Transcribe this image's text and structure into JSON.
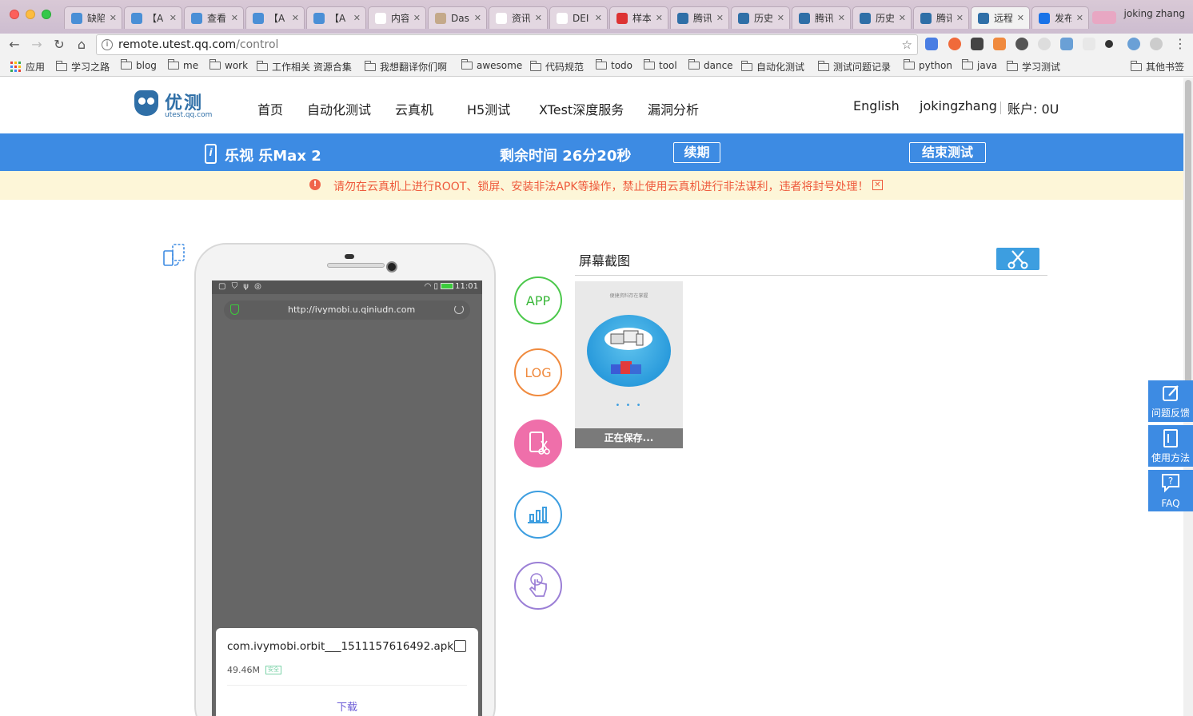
{
  "browser": {
    "profile_name": "joking zhang",
    "tabs": [
      {
        "title": "缺陷",
        "color": "#4a8fd6"
      },
      {
        "title": "【A",
        "color": "#4a8fd6"
      },
      {
        "title": "查看",
        "color": "#4a8fd6"
      },
      {
        "title": "【A",
        "color": "#4a8fd6"
      },
      {
        "title": "【A",
        "color": "#4a8fd6"
      },
      {
        "title": "内容",
        "color": "#ffffff"
      },
      {
        "title": "Das",
        "color": "#c4a98a"
      },
      {
        "title": "资讯",
        "color": "#ffffff"
      },
      {
        "title": "DEI",
        "color": "#ffffff"
      },
      {
        "title": "样本",
        "color": "#d33"
      },
      {
        "title": "腾讯",
        "color": "#2f6fa7"
      },
      {
        "title": "历史",
        "color": "#2f6fa7"
      },
      {
        "title": "腾讯",
        "color": "#2f6fa7"
      },
      {
        "title": "历史",
        "color": "#2f6fa7"
      },
      {
        "title": "腾讯",
        "color": "#2f6fa7"
      },
      {
        "title": "远程",
        "color": "#2f6fa7",
        "active": true
      },
      {
        "title": "发布",
        "color": "#1a73e8"
      }
    ],
    "url_host": "remote.utest.qq.com",
    "url_path": "/control",
    "bookmarks": [
      "应用",
      "学习之路",
      "blog",
      "me",
      "work",
      "工作相关 资源合集",
      "我想翻译你们啊",
      "awesome",
      "代码规范",
      "todo",
      "tool",
      "dance",
      "自动化测试",
      "测试问题记录",
      "python",
      "java",
      "学习测试"
    ],
    "other_bookmarks": "其他书签"
  },
  "site": {
    "brand": "优测",
    "domain": "utest.qq.com",
    "nav": [
      "首页",
      "自动化测试",
      "云真机",
      "H5测试",
      "XTest深度服务",
      "漏洞分析"
    ],
    "language": "English",
    "username": "jokingzhang",
    "account": "账户: 0U"
  },
  "device_bar": {
    "icon_letter": "i",
    "device_name": "乐视 乐Max 2",
    "remaining": "剩余时间 26分20秒",
    "renew_label": "续期",
    "end_label": "结束测试"
  },
  "warning": {
    "icon": "!",
    "text": "请勿在云真机上进行ROOT、锁屏、安装非法APK等操作，禁止使用云真机进行非法谋利，违者将封号处理！",
    "close": "✕"
  },
  "phone": {
    "status_left": "▢ ⛉ ψ ◎",
    "status_time": "11:01",
    "address": "http://ivymobi.u.qiniudn.com",
    "download": {
      "filename": "com.ivymobi.orbit___1511157616492.apk",
      "size": "49.46M",
      "tag": "安全",
      "button": "下载"
    }
  },
  "tools": {
    "app": "APP",
    "log": "LOG"
  },
  "screenshot": {
    "title": "屏幕截图",
    "thumb_caption": "便捷资料存在掌握",
    "thumb_dots": "• • •",
    "status": "正在保存..."
  },
  "sidebar": {
    "feedback": "问题反馈",
    "manual": "使用方法",
    "faq": "FAQ"
  }
}
